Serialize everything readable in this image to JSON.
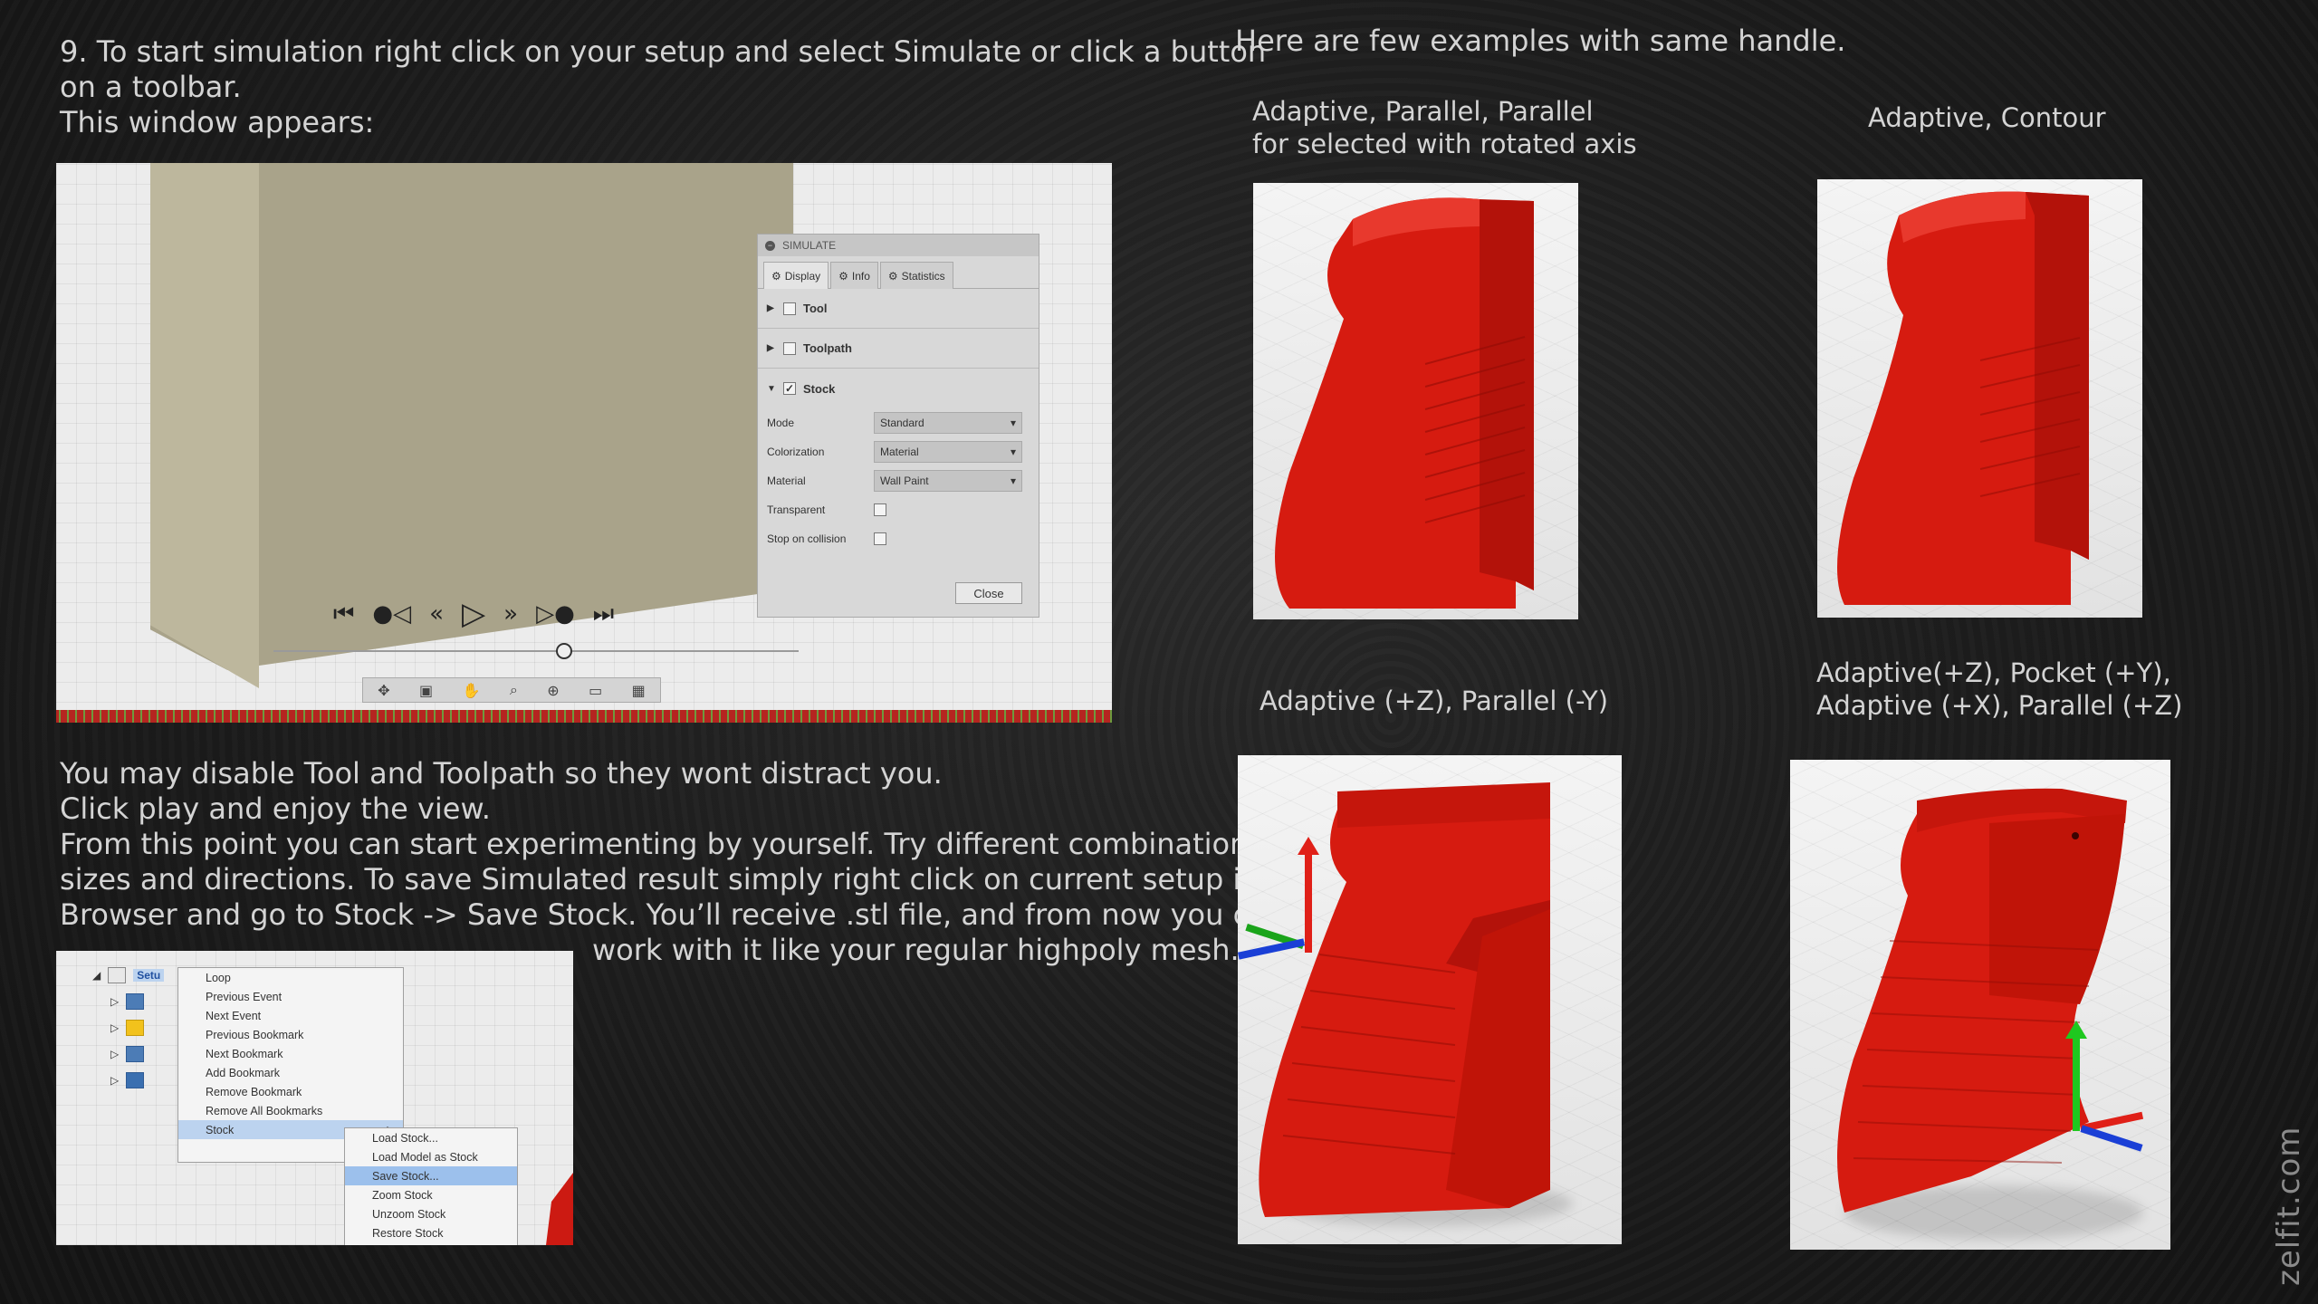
{
  "left_text": {
    "step_lines": [
      "9. To start simulation right click on your setup and select Simulate or click a button",
      "on a toolbar.",
      "This window appears:"
    ],
    "paragraph_lines": [
      "You may disable Tool and Toolpath so they wont distract you.",
      "Click play and enjoy the view.",
      "From this point you can start experimenting by yourself. Try different combinations,",
      " sizes and directions. To save Simulated result simply right click on current setup in",
      "Browser and go to Stock -> Save Stock. You’ll receive .stl file, and from now you can",
      "work with it like your regular highpoly mesh."
    ]
  },
  "simulate_panel": {
    "title": "SIMULATE",
    "tabs": [
      "Display",
      "Info",
      "Statistics"
    ],
    "sections": [
      {
        "label": "Tool",
        "checked": false,
        "expanded": false
      },
      {
        "label": "Toolpath",
        "checked": false,
        "expanded": false
      },
      {
        "label": "Stock",
        "checked": true,
        "expanded": true
      }
    ],
    "rows": [
      {
        "label": "Mode",
        "value": "Standard"
      },
      {
        "label": "Colorization",
        "value": "Material"
      },
      {
        "label": "Material",
        "value": "Wall Paint"
      }
    ],
    "checkbox_rows": [
      "Transparent",
      "Stop on collision"
    ],
    "close_label": "Close",
    "playback_icons": [
      "skip-to-start-icon",
      "previous-event-icon",
      "rewind-icon",
      "play-icon",
      "fast-forward-icon",
      "next-event-icon",
      "skip-to-end-icon"
    ]
  },
  "context_menu": {
    "setup_label": "Setu",
    "items": [
      "Loop",
      "Previous Event",
      "Next Event",
      "Previous Bookmark",
      "Next Bookmark",
      "Add Bookmark",
      "Remove Bookmark",
      "Remove All Bookmarks",
      "Stock"
    ],
    "stock_submenu": [
      "Load Stock...",
      "Load Model as Stock",
      "Save Stock...",
      "Zoom Stock",
      "Unzoom Stock",
      "Restore Stock"
    ],
    "highlighted_item": "Stock",
    "highlighted_subitem": "Save Stock..."
  },
  "examples": {
    "heading": "Here are few examples with same handle.",
    "captions": [
      [
        "Adaptive, Parallel, Parallel",
        "for selected with rotated axis"
      ],
      [
        "Adaptive, Contour"
      ],
      [
        "Adaptive (+Z), Parallel (-Y)"
      ],
      [
        "Adaptive(+Z), Pocket (+Y),",
        "Adaptive (+X), Parallel (+Z)"
      ]
    ]
  },
  "watermark": "zelfit.com",
  "colors": {
    "background": "#1c1c1c",
    "text": "#d4d4d4",
    "grip_red": "#d41a10",
    "stock_block": "#a9a38a"
  }
}
